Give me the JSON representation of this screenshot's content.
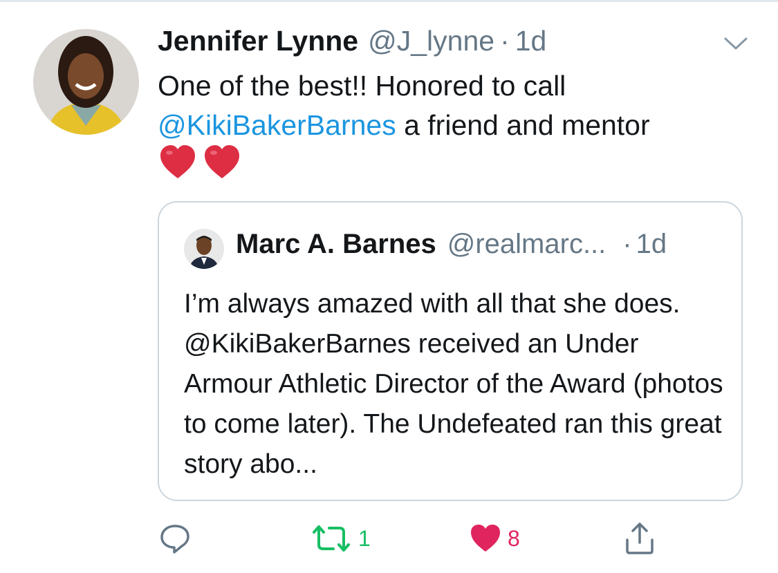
{
  "tweet": {
    "author_name": "Jennifer Lynne",
    "author_handle": "@J_lynne",
    "separator": "·",
    "time": "1d",
    "text_line1": "One of the best!! Honored to call",
    "mention": "@KikiBakerBarnes",
    "text_line2_rest": " a friend and mentor",
    "emoji": [
      "red-heart",
      "red-heart"
    ]
  },
  "quoted_tweet": {
    "author_name": "Marc A. Barnes",
    "author_handle": "@realmarc...",
    "separator": "·",
    "time": "1d",
    "text": "I’m always amazed with all that she does. @KikiBakerBarnes received an Under Armour Athletic Director of the Award (photos to come later). The Undefeated ran this great story abo..."
  },
  "actions": {
    "reply": {
      "icon": "reply-icon"
    },
    "retweet": {
      "icon": "retweet-icon",
      "count": "1"
    },
    "like": {
      "icon": "heart-icon",
      "count": "8"
    },
    "share": {
      "icon": "share-icon"
    }
  },
  "colors": {
    "link": "#1b95e0",
    "secondary_text": "#657786",
    "retweet_green": "#17bf63",
    "like_red": "#e0245e",
    "border": "#ccd6dd"
  }
}
